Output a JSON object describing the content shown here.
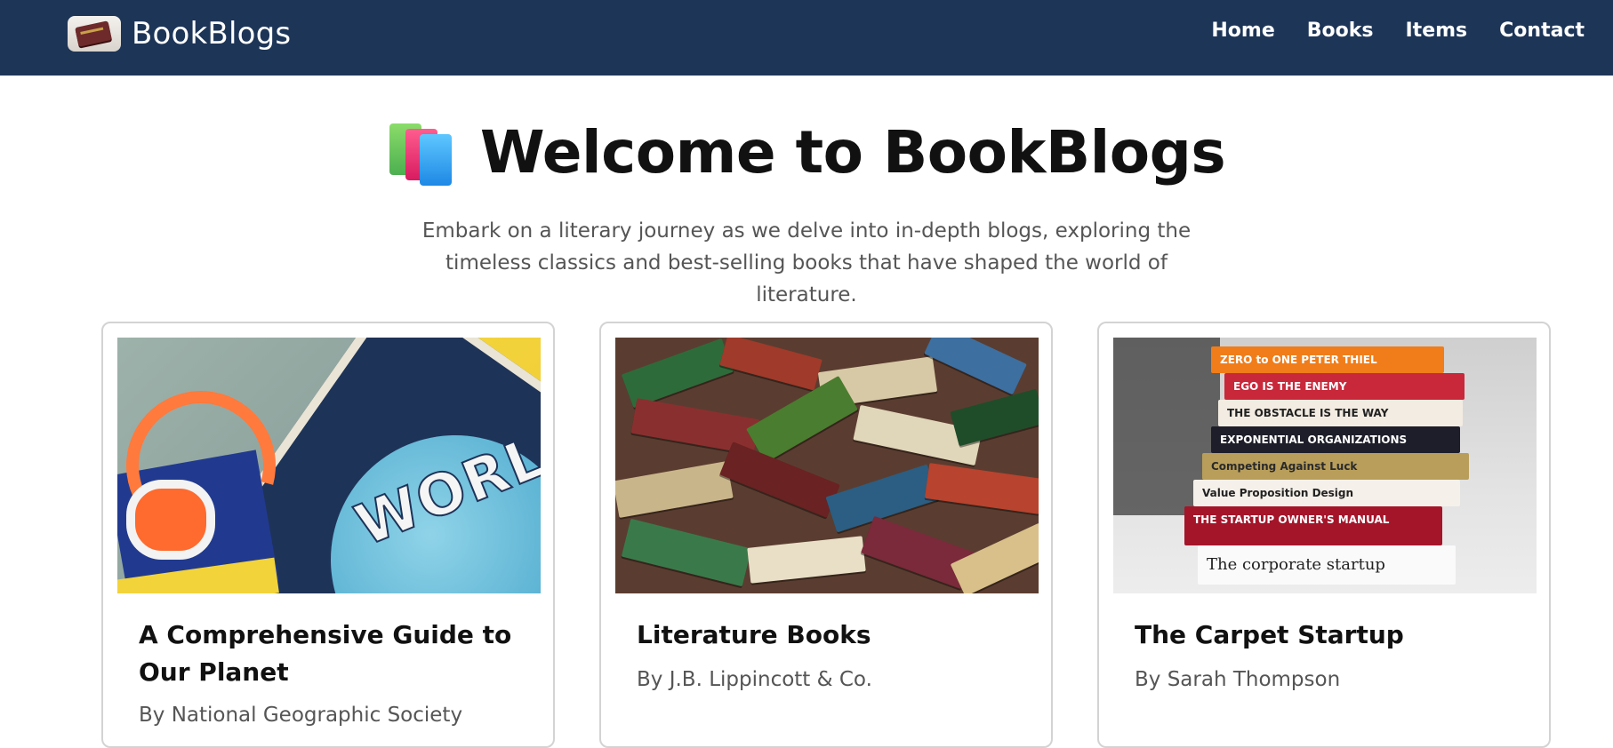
{
  "navbar": {
    "brand": "BookBlogs",
    "links": [
      "Home",
      "Books",
      "Items",
      "Contact"
    ]
  },
  "hero": {
    "title": "Welcome to BookBlogs",
    "subtitle": "Embark on a literary journey as we delve into in-depth blogs, exploring the timeless classics and best-selling books that have shaped the world of literature."
  },
  "cards": [
    {
      "title": "A Comprehensive Guide to Our Planet",
      "author": "By National Geographic Society"
    },
    {
      "title": "Literature Books",
      "author": "By J.B. Lippincott & Co."
    },
    {
      "title": "The Carpet Startup",
      "author": "By Sarah Thompson"
    }
  ],
  "images": {
    "atlas_text": "WORLD",
    "stack_spines": [
      "ZERO to ONE   PETER THIEL",
      "EGO IS THE ENEMY",
      "THE OBSTACLE IS THE WAY",
      "EXPONENTIAL ORGANIZATIONS",
      "Competing Against Luck",
      "Value Proposition Design",
      "THE STARTUP OWNER'S MANUAL",
      "The corporate startup"
    ]
  },
  "colors": {
    "navbar_bg": "#1d3557",
    "text_primary": "#111111",
    "text_secondary": "#555555",
    "card_border": "#d3d3d3"
  },
  "icons": {
    "brand_logo": "book-logo-icon",
    "hero_icon": "books-emoji-icon"
  }
}
